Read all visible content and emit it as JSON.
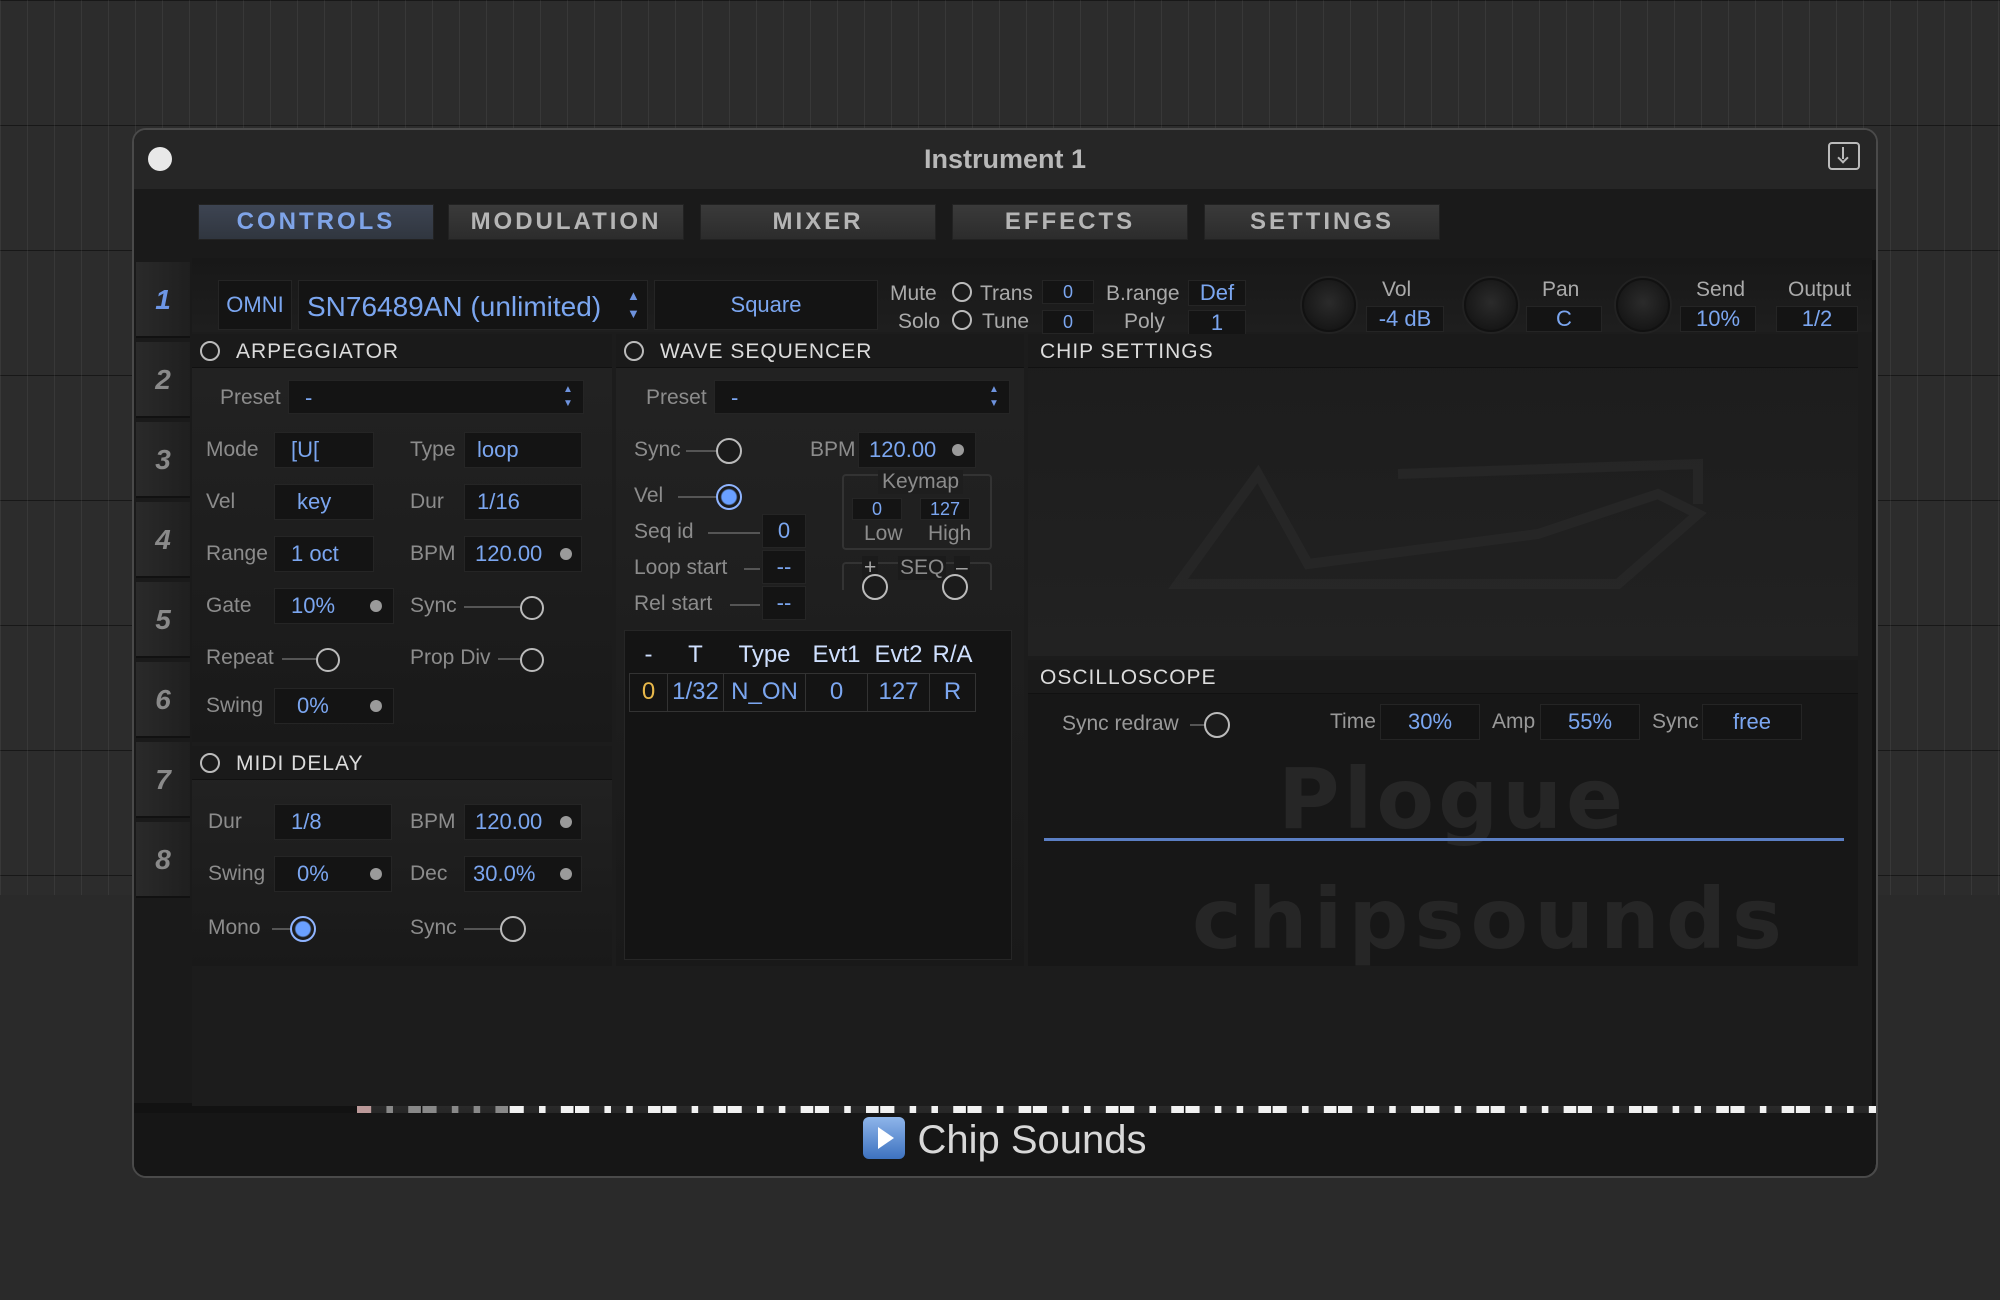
{
  "window": {
    "title": "Instrument 1"
  },
  "tabs": [
    {
      "label": "CONTROLS",
      "active": true
    },
    {
      "label": "MODULATION"
    },
    {
      "label": "MIXER"
    },
    {
      "label": "EFFECTS"
    },
    {
      "label": "SETTINGS"
    }
  ],
  "top_preset": {
    "value": "-"
  },
  "channels": [
    "1",
    "2",
    "3",
    "4",
    "5",
    "6",
    "7",
    "8"
  ],
  "header": {
    "midi": "OMNI",
    "chip": "SN76489AN (unlimited)",
    "waveform": "Square",
    "mute_label": "Mute",
    "solo_label": "Solo",
    "trans_label": "Trans",
    "trans_value": "0",
    "tune_label": "Tune",
    "tune_value": "0",
    "brange_label": "B.range",
    "brange_value": "Def",
    "poly_label": "Poly",
    "poly_value": "1",
    "vol_label": "Vol",
    "vol_value": "-4 dB",
    "pan_label": "Pan",
    "pan_value": "C",
    "send_label": "Send",
    "send_value": "10%",
    "output_label": "Output",
    "output_value": "1/2"
  },
  "arpeggiator": {
    "title": "ARPEGGIATOR",
    "preset_label": "Preset",
    "preset_value": "-",
    "mode_label": "Mode",
    "mode_value": "[U[",
    "type_label": "Type",
    "type_value": "loop",
    "vel_label": "Vel",
    "vel_value": "key",
    "dur_label": "Dur",
    "dur_value": "1/16",
    "range_label": "Range",
    "range_value": "1 oct",
    "bpm_label": "BPM",
    "bpm_value": "120.00",
    "gate_label": "Gate",
    "gate_value": "10%",
    "sync_label": "Sync",
    "repeat_label": "Repeat",
    "propdiv_label": "Prop Div",
    "swing_label": "Swing",
    "swing_value": "0%"
  },
  "midi_delay": {
    "title": "MIDI DELAY",
    "dur_label": "Dur",
    "dur_value": "1/8",
    "bpm_label": "BPM",
    "bpm_value": "120.00",
    "swing_label": "Swing",
    "swing_value": "0%",
    "dec_label": "Dec",
    "dec_value": "30.0%",
    "mono_label": "Mono",
    "sync_label": "Sync"
  },
  "wave_sequencer": {
    "title": "WAVE SEQUENCER",
    "preset_label": "Preset",
    "preset_value": "-",
    "sync_label": "Sync",
    "bpm_label": "BPM",
    "bpm_value": "120.00",
    "vel_label": "Vel",
    "keymap_label": "Keymap",
    "low_value": "0",
    "high_value": "127",
    "low_label": "Low",
    "high_label": "High",
    "seq_label": "SEQ",
    "plus": "+",
    "minus": "–",
    "seqid_label": "Seq id",
    "seqid_value": "0",
    "loopstart_label": "Loop start",
    "loopstart_value": "--",
    "relstart_label": "Rel start",
    "relstart_value": "--",
    "table": {
      "headers": [
        "-",
        "T",
        "Type",
        "Evt1",
        "Evt2",
        "R/A"
      ],
      "rows": [
        [
          "0",
          "1/32",
          "N_ON",
          "0",
          "127",
          "R"
        ]
      ]
    }
  },
  "chip_settings": {
    "title": "CHIP SETTINGS"
  },
  "oscilloscope": {
    "title": "OSCILLOSCOPE",
    "sync_redraw_label": "Sync redraw",
    "time_label": "Time",
    "time_value": "30%",
    "amp_label": "Amp",
    "amp_value": "55%",
    "sync_label": "Sync",
    "sync_value": "free"
  },
  "watermarks": {
    "logo": "Plogue",
    "brand": "chipsounds"
  },
  "footer": {
    "label": "Chip Sounds"
  },
  "icons": {
    "close": "close-dot-icon",
    "save": "save-download-icon",
    "play": "play-icon"
  },
  "colors": {
    "accent": "#7ba6f0",
    "background": "#1c1c1c"
  }
}
